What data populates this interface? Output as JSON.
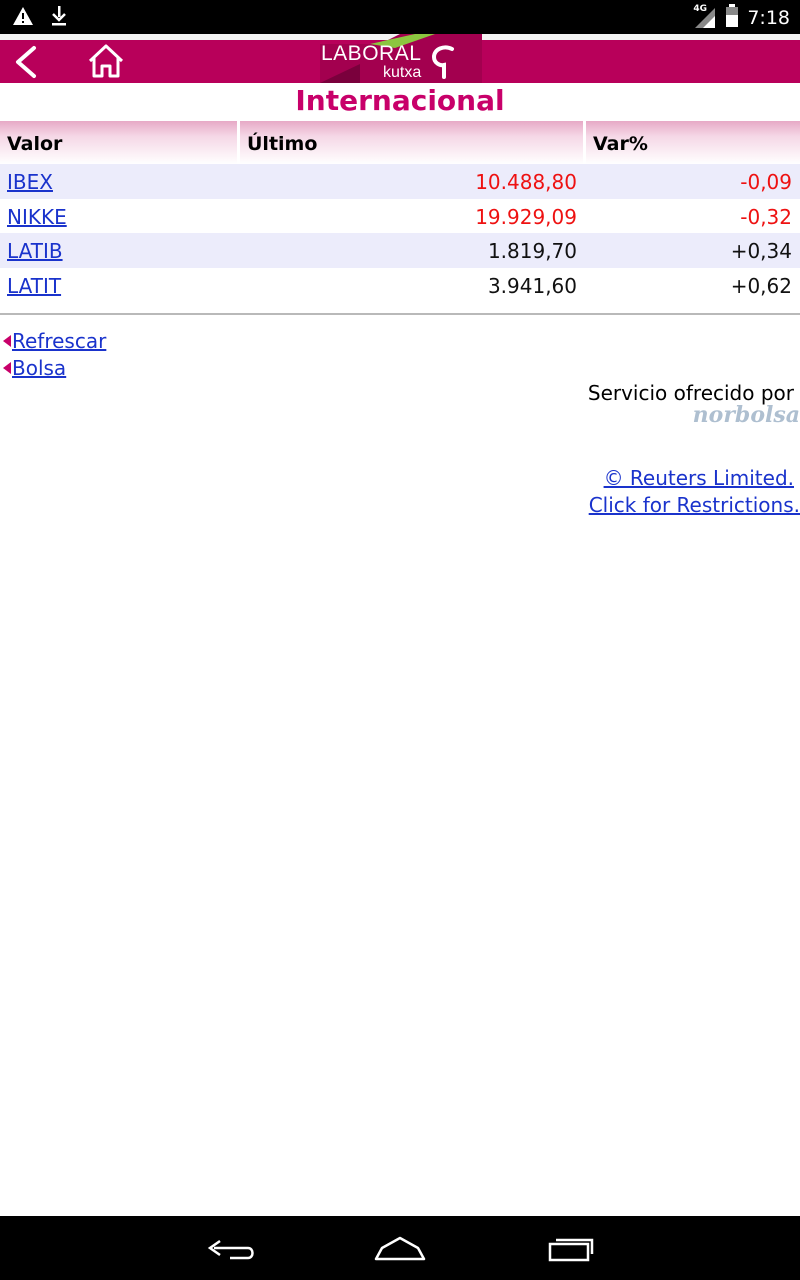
{
  "status_bar": {
    "time": "7:18",
    "network": "4G",
    "icons": [
      "warning-icon",
      "download-icon",
      "signal-icon",
      "battery-icon"
    ]
  },
  "header": {
    "logo_line1": "LABORAL",
    "logo_line2": "kutxa",
    "brand_color": "#b8005a"
  },
  "page": {
    "title": "Internacional"
  },
  "table": {
    "columns": [
      "Valor",
      "Último",
      "Var%"
    ],
    "rows": [
      {
        "valor": "IBEX",
        "ultimo": "10.488,80",
        "var": "-0,09",
        "trend": "neg"
      },
      {
        "valor": "NIKKE",
        "ultimo": "19.929,09",
        "var": "-0,32",
        "trend": "neg"
      },
      {
        "valor": "LATIB",
        "ultimo": "1.819,70",
        "var": "+0,34",
        "trend": "pos"
      },
      {
        "valor": "LATIT",
        "ultimo": "3.941,60",
        "var": "+0,62",
        "trend": "pos"
      }
    ]
  },
  "links": {
    "refresh": "Refrescar",
    "bolsa": "Bolsa",
    "served_by": "Servicio ofrecido por",
    "provider": "norbolsa",
    "reuters_line1": "© Reuters Limited.",
    "reuters_line2": "Click for Restrictions."
  },
  "colors": {
    "negative": "#ee1111",
    "positive": "#111111",
    "link": "#1a33cc",
    "title": "#c8006a"
  }
}
